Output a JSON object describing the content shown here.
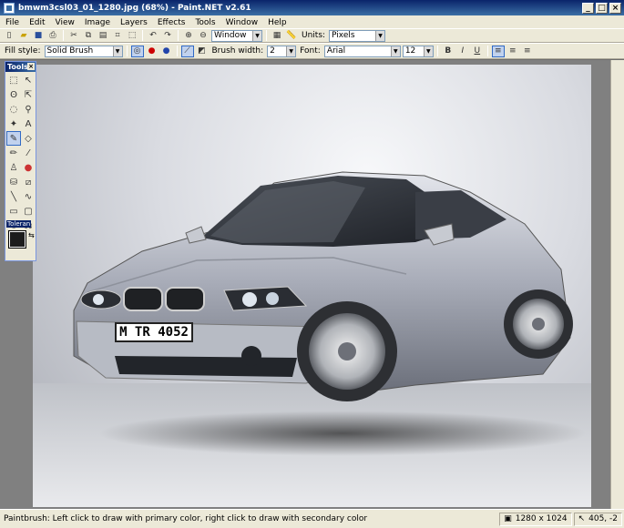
{
  "window": {
    "title": "bmwm3csl03_01_1280.jpg (68%) - Paint.NET v2.61",
    "controls": [
      "_",
      "□",
      "×"
    ]
  },
  "menu": [
    "File",
    "Edit",
    "View",
    "Image",
    "Layers",
    "Effects",
    "Tools",
    "Window",
    "Help"
  ],
  "toolbar": {
    "zoom_mode": "Window",
    "units_label": "Units:",
    "units_value": "Pixels"
  },
  "tool_options": {
    "fill_style_label": "Fill style:",
    "fill_style_value": "Solid Brush",
    "brush_width_label": "Brush width:",
    "brush_width_value": "2",
    "font_label": "Font:",
    "font_value": "Arial",
    "font_size": "12",
    "bold": "B",
    "italic": "I",
    "underline": "U"
  },
  "tools_panel": {
    "title": "Tools",
    "tolerance_label": "Toleran",
    "primary_color": "#1c1c1c",
    "secondary_color": "#ffffff"
  },
  "image": {
    "license_plate": "M TR 4052"
  },
  "statusbar": {
    "message": "Paintbrush: Left click to draw with primary color, right click to draw with secondary color",
    "image_size": "1280 x 1024",
    "cursor_pos": "405, -2"
  }
}
